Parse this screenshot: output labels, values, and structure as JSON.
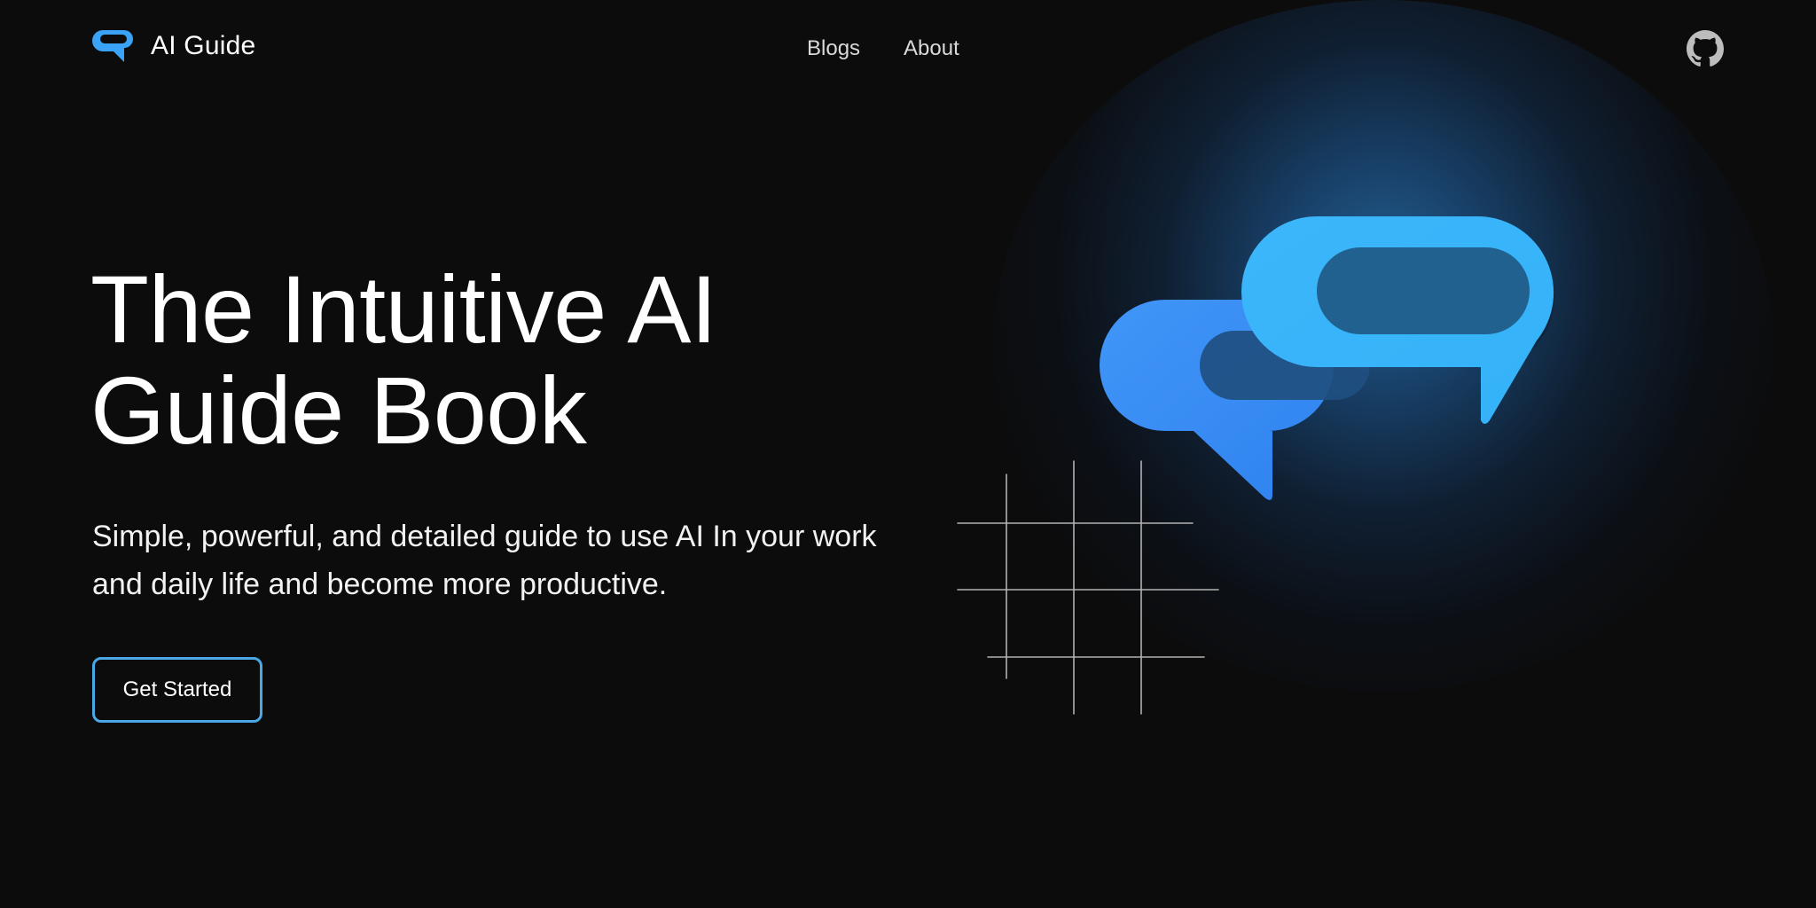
{
  "header": {
    "brand_name": "AI Guide",
    "logo_icon": "chat-bubble-icon",
    "nav": [
      {
        "label": "Blogs"
      },
      {
        "label": "About"
      }
    ],
    "github_icon": "github-icon"
  },
  "hero": {
    "title_line_1": "The Intuitive AI",
    "title_line_2": "Guide Book",
    "subtitle": "Simple, powerful, and detailed guide to use AI In your work and daily life and become more productive.",
    "cta_label": "Get Started"
  },
  "illustration": {
    "icon": "chat-bubbles-icon",
    "decoration": "grid-lines",
    "colors": {
      "bubble_front": "#3aa3f8",
      "bubble_back": "#3b8ff5",
      "glow": "#2a6fa8",
      "grid": "#cfcfcf",
      "accent": "#4aa8e6",
      "background": "#0c0c0d"
    }
  }
}
